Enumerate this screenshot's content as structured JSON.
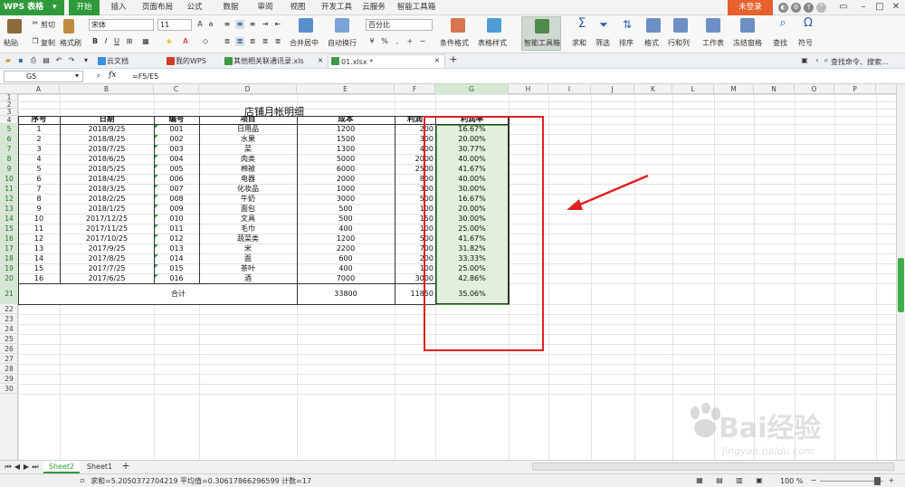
{
  "app": {
    "brand": "WPS 表格",
    "menu_tabs": [
      "开始",
      "插入",
      "页面布局",
      "公式",
      "数据",
      "审阅",
      "视图",
      "开发工具",
      "云服务",
      "智能工具箱"
    ],
    "login": "未登录"
  },
  "ribbon": {
    "paste": "粘贴",
    "cut": "剪切",
    "copy": "复制",
    "format_painter": "格式刷",
    "font_name": "宋体",
    "font_size": "11",
    "merge_center": "合并居中",
    "wrap_text": "自动换行",
    "number_format": "百分比",
    "cond_format": "条件格式",
    "table_style": "表格样式",
    "smart_toolbox": "智能工具箱",
    "sum": "求和",
    "filter": "筛选",
    "sort": "排序",
    "format": "格式",
    "row_col": "行和列",
    "worksheet": "工作表",
    "freeze": "冻结窗格",
    "find": "查找",
    "symbol": "符号"
  },
  "doc_tabs": [
    {
      "label": "云文档"
    },
    {
      "label": "我的WPS"
    },
    {
      "label": "其他相关联通讯录.xls"
    },
    {
      "label": "01.xlsx *"
    }
  ],
  "search_placeholder": "查找命令、搜索...",
  "formula_bar": {
    "cell_ref": "G5",
    "fx": "fx",
    "formula": "=F5/E5"
  },
  "columns": [
    "A",
    "B",
    "C",
    "D",
    "E",
    "F",
    "G",
    "H",
    "I",
    "J",
    "K",
    "L",
    "M",
    "N",
    "O",
    "P"
  ],
  "rows": [
    "1",
    "2",
    "3",
    "4",
    "5",
    "6",
    "7",
    "8",
    "9",
    "10",
    "11",
    "12",
    "13",
    "14",
    "15",
    "16",
    "17",
    "18",
    "19",
    "20",
    "21",
    "22",
    "23",
    "24",
    "25",
    "26",
    "27",
    "28",
    "29",
    "30"
  ],
  "sheet": {
    "title": "店铺月帐明细",
    "headers": [
      "序号",
      "日期",
      "编号",
      "项目",
      "成本",
      "利润",
      "利润率"
    ],
    "records": [
      [
        "1",
        "2018/9/25",
        "001",
        "日用品",
        "1200",
        "200",
        "16.67%"
      ],
      [
        "2",
        "2018/8/25",
        "002",
        "水果",
        "1500",
        "300",
        "20.00%"
      ],
      [
        "3",
        "2018/7/25",
        "003",
        "菜",
        "1300",
        "400",
        "30.77%"
      ],
      [
        "4",
        "2018/6/25",
        "004",
        "肉类",
        "5000",
        "2000",
        "40.00%"
      ],
      [
        "5",
        "2018/5/25",
        "005",
        "棉被",
        "6000",
        "2500",
        "41.67%"
      ],
      [
        "6",
        "2018/4/25",
        "006",
        "电器",
        "2000",
        "800",
        "40.00%"
      ],
      [
        "7",
        "2018/3/25",
        "007",
        "化妆品",
        "1000",
        "300",
        "30.00%"
      ],
      [
        "8",
        "2018/2/25",
        "008",
        "牛奶",
        "3000",
        "500",
        "16.67%"
      ],
      [
        "9",
        "2018/1/25",
        "009",
        "面包",
        "500",
        "100",
        "20.00%"
      ],
      [
        "10",
        "2017/12/25",
        "010",
        "文具",
        "500",
        "150",
        "30.00%"
      ],
      [
        "11",
        "2017/11/25",
        "011",
        "毛巾",
        "400",
        "100",
        "25.00%"
      ],
      [
        "12",
        "2017/10/25",
        "012",
        "蔬菜类",
        "1200",
        "500",
        "41.67%"
      ],
      [
        "13",
        "2017/9/25",
        "013",
        "米",
        "2200",
        "700",
        "31.82%"
      ],
      [
        "14",
        "2017/8/25",
        "014",
        "面",
        "600",
        "200",
        "33.33%"
      ],
      [
        "15",
        "2017/7/25",
        "015",
        "茶叶",
        "400",
        "100",
        "25.00%"
      ],
      [
        "16",
        "2017/6/25",
        "016",
        "酒",
        "7000",
        "3000",
        "42.86%"
      ]
    ],
    "total_label": "合计",
    "total_cost": "33800",
    "total_profit": "11850",
    "total_rate": "35.06%"
  },
  "sheet_tabs": [
    "Sheet2",
    "Sheet1"
  ],
  "status": {
    "summary": "求和=5.2050372704219   平均值=0.30617866296599   计数=17",
    "zoom": "100 %"
  },
  "watermark": {
    "text": "Bai经验",
    "url": "jingyan.baidu.com"
  },
  "colors": {
    "brand_green": "#2f9a3b",
    "login_orange": "#e8602c",
    "highlight_red": "#e02020",
    "selection_fill": "#e2efda"
  }
}
